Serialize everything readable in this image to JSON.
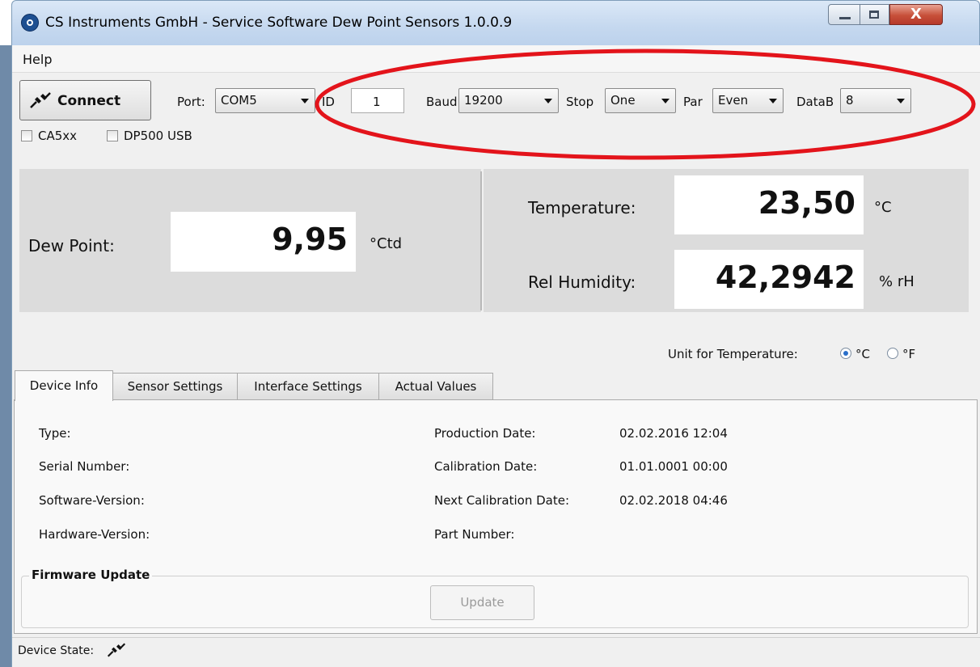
{
  "window": {
    "title": "CS Instruments GmbH - Service Software Dew Point Sensors  1.0.0.9",
    "close_glyph": "X"
  },
  "menu": {
    "help": "Help"
  },
  "connection": {
    "connect_label": "Connect",
    "port_label": "Port:",
    "port_value": "COM5",
    "id_label": "ID",
    "id_value": "1",
    "baud_label": "Baud",
    "baud_value": "19200",
    "stop_label": "Stop",
    "stop_value": "One",
    "par_label": "Par",
    "par_value": "Even",
    "datab_label": "DataB",
    "datab_value": "8",
    "ca5xx_label": "CA5xx",
    "ca5xx_checked": false,
    "dp500_label": "DP500 USB",
    "dp500_checked": false
  },
  "annotation": {
    "color": "#e3141b"
  },
  "readings": {
    "dew_point_label": "Dew Point:",
    "dew_point_value": "9,95",
    "dew_point_unit": "°Ctd",
    "temperature_label": "Temperature:",
    "temperature_value": "23,50",
    "temperature_unit": "°C",
    "humidity_label": "Rel Humidity:",
    "humidity_value": "42,2942",
    "humidity_unit": "% rH"
  },
  "unit_selector": {
    "label": "Unit for Temperature:",
    "celsius": "°C",
    "fahrenheit": "°F",
    "selected": "°C"
  },
  "tabs": [
    {
      "label": "Device Info",
      "active": true
    },
    {
      "label": "Sensor Settings",
      "active": false
    },
    {
      "label": "Interface Settings",
      "active": false
    },
    {
      "label": "Actual Values",
      "active": false
    }
  ],
  "device_info": {
    "type_label": "Type:",
    "serial_label": "Serial Number:",
    "software_label": "Software-Version:",
    "hardware_label": "Hardware-Version:",
    "production_label": "Production Date:",
    "production_value": "02.02.2016 12:04",
    "calibration_label": "Calibration Date:",
    "calibration_value": "01.01.0001 00:00",
    "next_calibration_label": "Next Calibration Date:",
    "next_calibration_value": "02.02.2018 04:46",
    "part_label": "Part Number:"
  },
  "firmware": {
    "title": "Firmware Update",
    "update_label": "Update",
    "update_enabled": false
  },
  "status": {
    "label": "Device State:"
  }
}
